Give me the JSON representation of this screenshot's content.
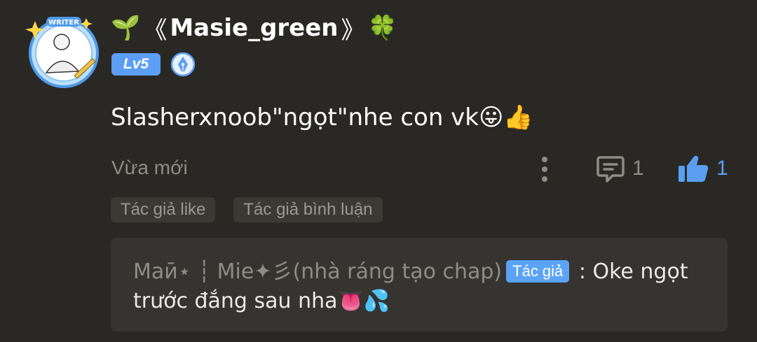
{
  "comment": {
    "author": {
      "prefix_emoji": "🌱",
      "open_bracket": "《",
      "name": "Masie_green",
      "close_bracket": "》",
      "suffix_emoji": "🍀",
      "level": "Lv5",
      "avatar_label": "WRITER"
    },
    "text": "Slasherxnoob\"ngọt\"nhe con vk😛👍",
    "time": "Vừa mới",
    "reply_count": "1",
    "like_count": "1",
    "tags": [
      "Tác giả like",
      "Tác giả bình luận"
    ],
    "reply": {
      "author": "Маӣ⋆ ┆ Mie✦彡(nhà ráng tạo chap)",
      "badge": "Tác giả",
      "separator": " : ",
      "text": "Oke ngọt trước đắng sau nha👅💦"
    }
  },
  "colors": {
    "background": "#2a2824",
    "accent_blue": "#5d9ef5",
    "muted_text": "#8f8c86",
    "reply_box": "#363430"
  },
  "icons": {
    "avatar": "writer-avatar-icon",
    "pen_badge": "pen-nib-badge-icon",
    "more": "vertical-dots-icon",
    "reply": "speech-bubble-icon",
    "like": "thumbs-up-icon"
  }
}
